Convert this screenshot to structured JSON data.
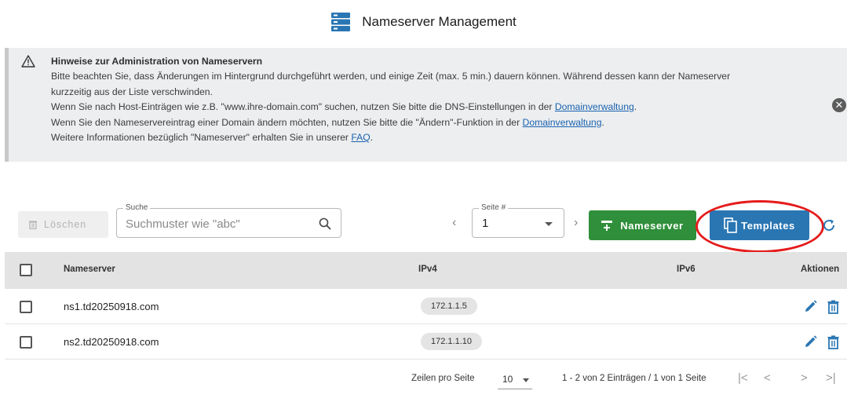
{
  "page": {
    "title": "Nameserver Management",
    "title_icon": "server-rack-icon"
  },
  "notice": {
    "icon": "warning-triangle-icon",
    "title": "Hinweise zur Administration von Nameservern",
    "line1": "Bitte beachten Sie, dass Änderungen im Hintergrund durchgeführt werden, und einige Zeit (max. 5 min.) dauern können. Während dessen kann der Nameserver",
    "line2": "kurzzeitig aus der Liste verschwinden.",
    "line3_pre": "Wenn Sie nach Host-Einträgen wie z.B. \"www.ihre-domain.com\" suchen, nutzen Sie bitte die DNS-Einstellungen in der ",
    "line3_link": "Domainverwaltung",
    "line3_post": ".",
    "line4_pre": "Wenn Sie den Nameservereintrag einer Domain ändern möchten, nutzen Sie bitte die \"Ändern\"-Funktion in der ",
    "line4_link": "Domainverwaltung",
    "line4_post": ".",
    "line5_pre": "Weitere Informationen bezüglich \"Nameserver\" erhalten Sie in unserer ",
    "line5_link": "FAQ",
    "line5_post": ".",
    "close_icon": "close-circle-icon",
    "close_glyph": "✕"
  },
  "toolbar": {
    "delete_label": "Löschen",
    "search_legend": "Suche",
    "search_placeholder": "Suchmuster wie \"abc\"",
    "page_legend": "Seite #",
    "page_value": "1",
    "prev_glyph": "‹",
    "next_glyph": "›",
    "add_nameserver_label": "Nameserver",
    "templates_label": "Templates",
    "highlight_color": "#e51c1c"
  },
  "table": {
    "columns": {
      "nameserver": "Nameserver",
      "ipv4": "IPv4",
      "ipv6": "IPv6",
      "actions": "Aktionen"
    },
    "rows": [
      {
        "nameserver": "ns1.td20250918.com",
        "ipv4": "172.1.1.5",
        "ipv6": ""
      },
      {
        "nameserver": "ns2.td20250918.com",
        "ipv4": "172.1.1.10",
        "ipv6": ""
      }
    ]
  },
  "pagination": {
    "rows_per_page_label": "Zeilen pro Seite",
    "rows_per_page_value": "10",
    "range_text": "1 - 2 von 2 Einträgen / 1 von 1 Seite",
    "first_glyph": "|<",
    "prev_glyph": "<",
    "next_glyph": ">",
    "last_glyph": ">|"
  },
  "colors": {
    "accent_green": "#2f8f3a",
    "accent_blue": "#2a76b3",
    "link": "#1a62b0"
  }
}
